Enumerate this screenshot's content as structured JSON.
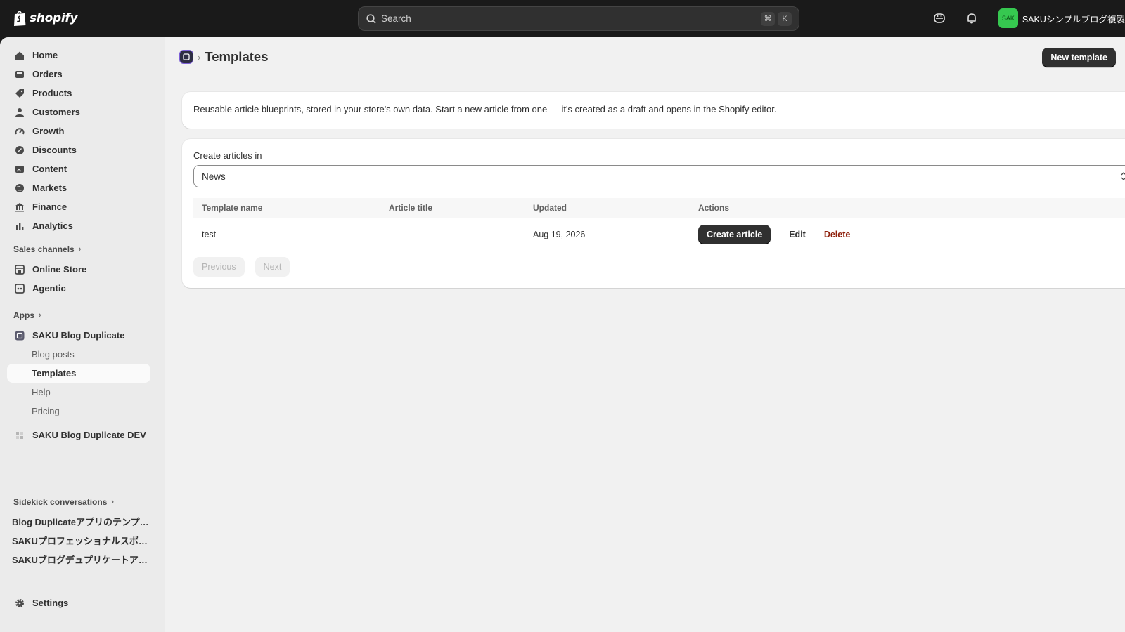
{
  "topbar": {
    "logo_text": "shopify",
    "search_placeholder": "Search",
    "shortcut_keys": [
      "⌘",
      "K"
    ],
    "store_avatar": "SAK",
    "store_name": "SAKUシンプルブログ複製",
    "avatar_color": "#36c850"
  },
  "sidebar": {
    "main_items": [
      {
        "label": "Home",
        "icon": "home-icon"
      },
      {
        "label": "Orders",
        "icon": "inbox-icon"
      },
      {
        "label": "Products",
        "icon": "tag-icon"
      },
      {
        "label": "Customers",
        "icon": "person-icon"
      },
      {
        "label": "Growth",
        "icon": "gauge-icon"
      },
      {
        "label": "Discounts",
        "icon": "discount-icon"
      },
      {
        "label": "Content",
        "icon": "image-icon"
      },
      {
        "label": "Markets",
        "icon": "globe-icon"
      },
      {
        "label": "Finance",
        "icon": "bank-icon"
      },
      {
        "label": "Analytics",
        "icon": "bar-chart-icon"
      }
    ],
    "sales_channels_title": "Sales channels",
    "sales_channels": [
      {
        "label": "Online Store",
        "icon": "store-icon"
      },
      {
        "label": "Agentic",
        "icon": "agentic-icon"
      }
    ],
    "apps_title": "Apps",
    "app_name": "SAKU Blog Duplicate",
    "app_subitems": [
      "Blog posts",
      "Templates",
      "Help",
      "Pricing"
    ],
    "active_subitem": "Templates",
    "dev_app_name": "SAKU Blog Duplicate DEV",
    "sidekick_title": "Sidekick conversations",
    "conversations": [
      "Blog Duplicateアプリのテンプレート",
      "SAKUプロフェッショナルスポーツ",
      "SAKUブログデュプリケートアプリ"
    ],
    "settings_label": "Settings"
  },
  "page": {
    "title": "Templates",
    "new_template_label": "New template",
    "description": "Reusable article blueprints, stored in your store's own data. Start a new article from one — it's created as a draft and opens in the Shopify editor.",
    "blog_select_label": "Create articles in",
    "blog_select_value": "News",
    "table_headers": [
      "Template name",
      "Article title",
      "Updated",
      "Actions"
    ],
    "rows": [
      {
        "name": "test",
        "article_title": "—",
        "updated": "Aug 19, 2026"
      }
    ],
    "action_create": "Create article",
    "action_edit": "Edit",
    "action_delete": "Delete",
    "pager_previous": "Previous",
    "pager_next": "Next"
  }
}
